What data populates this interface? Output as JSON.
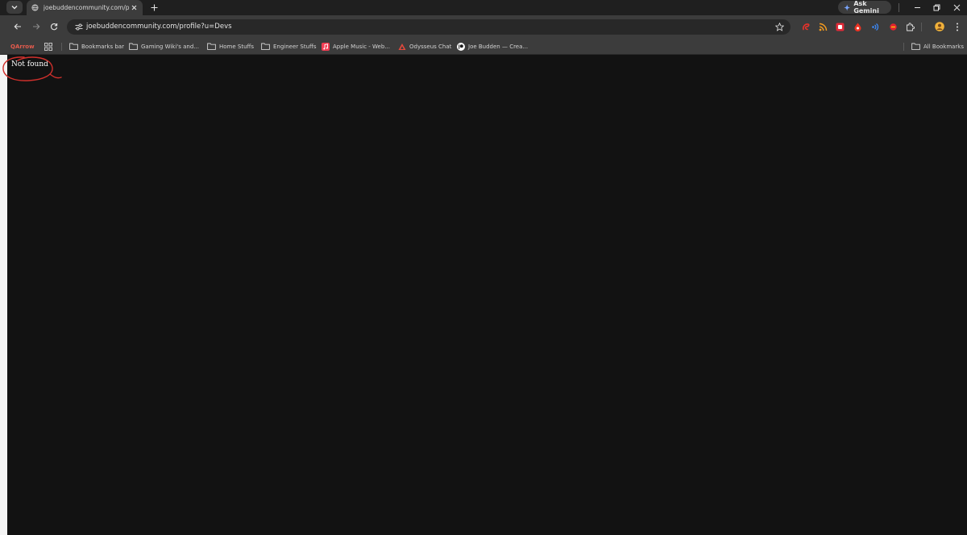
{
  "tab": {
    "title": "joebuddencommunity.com/profile?u=Devs"
  },
  "toolbar": {
    "url": "joebuddencommunity.com/profile?u=Devs"
  },
  "gemini": {
    "label": "Ask Gemini"
  },
  "bookmarks": {
    "qarrow": "QArrow",
    "items": [
      {
        "label": "Bookmarks bar"
      },
      {
        "label": "Gaming Wiki's and..."
      },
      {
        "label": "Home Stuffs"
      },
      {
        "label": "Engineer Stuffs"
      },
      {
        "label": "Apple Music - Web..."
      },
      {
        "label": "Odysseus Chat"
      },
      {
        "label": "Joe Budden — Crea..."
      }
    ],
    "all_bookmarks": "All Bookmarks"
  },
  "page": {
    "message": "Not found"
  },
  "colors": {
    "annotation": "#d0302c",
    "page_bg": "#121212"
  }
}
